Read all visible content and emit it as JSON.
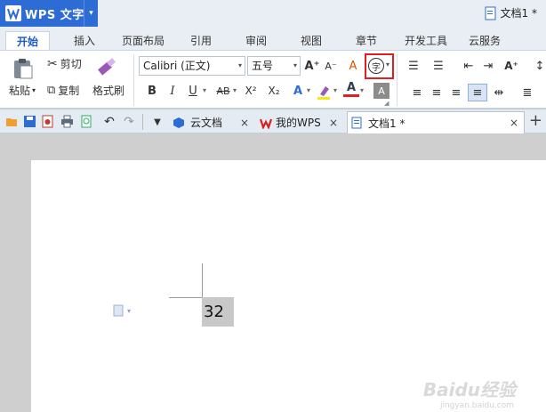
{
  "titlebar": {
    "app_name": "WPS 文字",
    "doc_title": "文档1 *"
  },
  "menu": {
    "tabs": [
      "开始",
      "插入",
      "页面布局",
      "引用",
      "审阅",
      "视图",
      "章节",
      "开发工具",
      "云服务"
    ]
  },
  "ribbon": {
    "paste": "粘贴",
    "cut": "剪切",
    "copy": "复制",
    "format_painter": "格式刷",
    "font_name": "Calibri (正文)",
    "font_size": "五号",
    "bold": "B",
    "italic": "I",
    "underline": "U",
    "strikethrough": "AB",
    "superscript": "X²",
    "subscript": "X₂",
    "text_effect": "A",
    "font_color": "A",
    "grow_font": "A⁺",
    "shrink_font": "A⁻",
    "clear_format": "A",
    "pinyin": "字"
  },
  "doc_tabs": [
    {
      "label": "云文档",
      "close": "×"
    },
    {
      "label": "我的WPS",
      "close": "×"
    },
    {
      "label": "文档1 *",
      "close": "×"
    }
  ],
  "new_tab": "+",
  "document": {
    "cell_text": "32"
  },
  "watermark": {
    "text": "Baidu经验",
    "sub": "jingyan.baidu.com"
  }
}
